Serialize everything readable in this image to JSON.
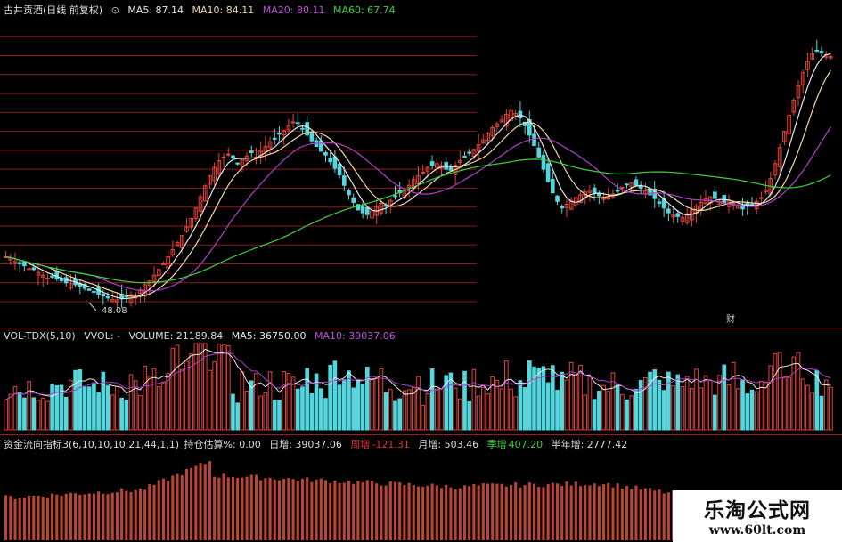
{
  "colors": {
    "up": "#e0453a",
    "down": "#54d6de",
    "ma5": "#e8e8e8",
    "ma10": "#f0d8a0",
    "ma20": "#b040c8",
    "ma60": "#3ecf3e",
    "grid": "#8b1a1a",
    "flow": "#b84535"
  },
  "price_panel": {
    "stock_name": "古井贡酒(日线 前复权)",
    "ma5": "MA5: 87.14",
    "ma10": "MA10: 84.11",
    "ma20": "MA20: 80.11",
    "ma60": "MA60: 67.74",
    "low_label": "48.08",
    "event_marker": "财",
    "price_min": 45,
    "price_max": 108,
    "gridlines": [
      104,
      100,
      96,
      92,
      88,
      84,
      80,
      76,
      72,
      68,
      64,
      60,
      56,
      52,
      48
    ],
    "closes": [
      57.5,
      57.2,
      56.5,
      56.0,
      55.6,
      55.0,
      54.8,
      54.2,
      53.6,
      53.0,
      53.2,
      52.8,
      52.4,
      52.0,
      51.8,
      51.6,
      51.3,
      50.8,
      50.4,
      50.0,
      49.6,
      49.2,
      48.8,
      48.5,
      48.4,
      48.6,
      49.0,
      49.5,
      49.2,
      50.5,
      51.6,
      52.4,
      53.6,
      54.8,
      56.0,
      57.5,
      59.0,
      60.5,
      62.0,
      63.8,
      65.6,
      67.8,
      70.2,
      72.5,
      74.6,
      76.4,
      77.8,
      78.6,
      79.2,
      78.4,
      77.2,
      78.0,
      78.8,
      79.5,
      78.6,
      79.8,
      80.8,
      81.8,
      82.4,
      83.4,
      84.2,
      85.2,
      86.0,
      85.8,
      84.6,
      83.2,
      82.0,
      80.8,
      79.8,
      79.0,
      77.6,
      76.2,
      74.8,
      72.6,
      70.6,
      69.0,
      67.4,
      66.8,
      66.4,
      67.2,
      68.0,
      68.8,
      68.2,
      69.4,
      70.4,
      71.0,
      71.6,
      72.6,
      73.8,
      74.6,
      75.4,
      76.4,
      76.8,
      77.2,
      76.8,
      76.0,
      75.8,
      76.8,
      77.8,
      78.6,
      79.4,
      80.2,
      81.2,
      82.2,
      83.6,
      84.8,
      85.6,
      86.4,
      87.6,
      88.4,
      87.8,
      86.8,
      85.2,
      83.2,
      81.0,
      78.6,
      76.0,
      73.4,
      71.0,
      69.2,
      67.8,
      68.6,
      69.4,
      70.0,
      70.6,
      71.2,
      71.6,
      71.0,
      70.4,
      69.8,
      70.2,
      70.8,
      71.4,
      72.2,
      72.8,
      73.2,
      72.6,
      72.0,
      71.4,
      70.6,
      69.8,
      68.8,
      67.8,
      66.8,
      66.4,
      66.0,
      65.8,
      66.6,
      67.4,
      68.2,
      69.0,
      69.8,
      70.2,
      69.8,
      69.2,
      68.8,
      69.4,
      68.8,
      68.2,
      67.6,
      68.2,
      68.6,
      69.2,
      70.0,
      71.6,
      74.0,
      77.2,
      80.6,
      84.0,
      87.4,
      90.6,
      93.6,
      96.4,
      98.8,
      100.4,
      101.0,
      100.6,
      100.2,
      99.8
    ],
    "last_visible_index": 178
  },
  "volume_panel": {
    "indicator": "VOL-TDX(5,10)",
    "vvol": "VVOL: -",
    "volume": "VOLUME: 21189.84",
    "ma5": "MA5: 36750.00",
    "ma10": "MA10: 39037.06"
  },
  "flow_panel": {
    "indicator": "资金流向指标3(6,10,10,10,21,44,1,1)",
    "position_label": "持仓估算%: 0.00",
    "day_label": "日增: 39037.06",
    "week_label": "周增",
    "week_value": "-121.31",
    "month_label": "月增: 503.46",
    "season_label": "季增",
    "season_value": "407.20",
    "half_year_label": "半年增: 2777.42"
  },
  "watermark": {
    "title": "乐淘公式网",
    "url": "www.60lt.com"
  }
}
